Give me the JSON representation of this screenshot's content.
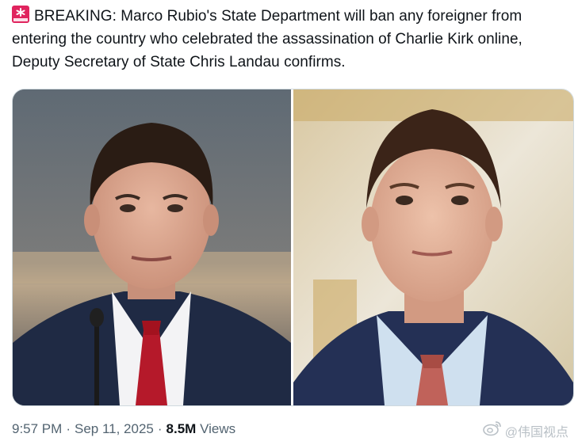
{
  "tweet": {
    "text": "BREAKING: Marco Rubio's State Department will ban any foreigner from entering the country who celebrated the assassination of Charlie Kirk online, Deputy Secretary of State Chris Landau confirms.",
    "icon": "police-light-icon"
  },
  "media": {
    "left_photo_icon": "portrait-photo",
    "right_photo_icon": "portrait-photo"
  },
  "meta": {
    "time": "9:57 PM",
    "separator": "·",
    "date": "Sep 11, 2025",
    "views_count": "8.5M",
    "views_label": "Views"
  },
  "watermark": {
    "text": "@伟国视点",
    "icon": "weibo-logo-icon"
  },
  "colors": {
    "text": "#0f1419",
    "secondary": "#536471",
    "border": "#cfd9de",
    "siren": "#e0245e"
  }
}
